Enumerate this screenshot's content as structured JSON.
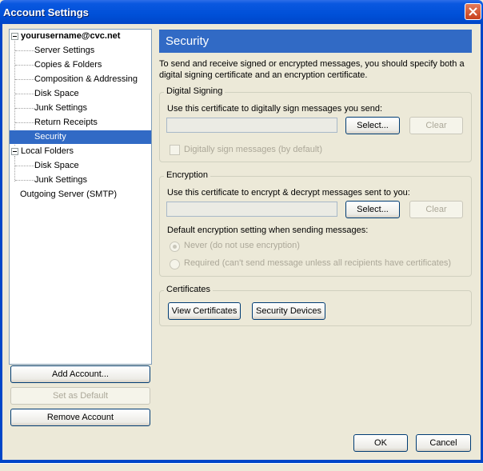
{
  "window": {
    "title": "Account Settings"
  },
  "tree": {
    "account_name": "yourusername@cvc.net",
    "account_children": [
      "Server Settings",
      "Copies & Folders",
      "Composition & Addressing",
      "Disk Space",
      "Junk Settings",
      "Return Receipts",
      "Security"
    ],
    "selected": "Security",
    "local_folders": "Local Folders",
    "local_children": [
      "Disk Space",
      "Junk Settings"
    ],
    "outgoing_server": "Outgoing Server (SMTP)"
  },
  "left_buttons": {
    "add_account": "Add Account...",
    "set_default": "Set as Default",
    "remove_account": "Remove Account"
  },
  "security": {
    "header": "Security",
    "description": "To send and receive signed or encrypted messages, you should specify both a digital signing certificate and an encryption certificate.",
    "digital_signing": {
      "legend": "Digital Signing",
      "label": "Use this certificate to digitally sign messages you send:",
      "select_label": "Select...",
      "clear_label": "Clear",
      "checkbox_label": "Digitally sign messages (by default)",
      "checked": false
    },
    "encryption": {
      "legend": "Encryption",
      "label": "Use this certificate to encrypt & decrypt messages sent to you:",
      "select_label": "Select...",
      "clear_label": "Clear",
      "default_label": "Default encryption setting when sending messages:",
      "option_never": "Never (do not use encryption)",
      "option_required": "Required (can't send message unless all recipients have certificates)",
      "selected_option": "never"
    },
    "certificates": {
      "legend": "Certificates",
      "view_label": "View Certificates",
      "devices_label": "Security Devices"
    }
  },
  "dialog_buttons": {
    "ok": "OK",
    "cancel": "Cancel"
  },
  "colors": {
    "title_bar": "#0050d8",
    "selection": "#316ac5",
    "dialog_bg": "#ece9d8"
  }
}
